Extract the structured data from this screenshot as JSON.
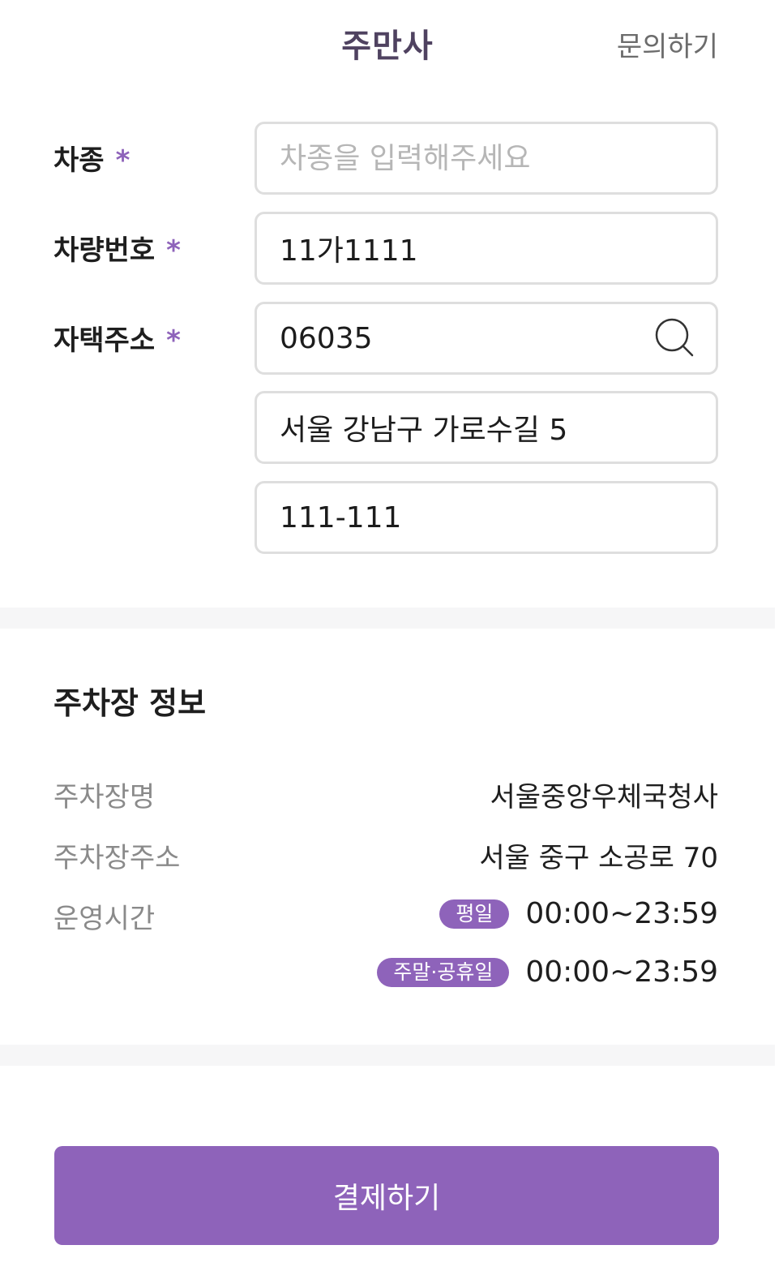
{
  "header": {
    "title": "주만사",
    "inquiry_label": "문의하기"
  },
  "form": {
    "required_mark": "*",
    "car_model": {
      "label": "차종",
      "placeholder": "차종을 입력해주세요",
      "value": ""
    },
    "plate_number": {
      "label": "차량번호",
      "value": "11가1111"
    },
    "home_address": {
      "label": "자택주소",
      "postal_code": "06035",
      "address": "서울 강남구 가로수길 5",
      "detail": "111-111"
    }
  },
  "parking_info": {
    "section_title": "주차장 정보",
    "name_label": "주차장명",
    "name_value": "서울중앙우체국청사",
    "address_label": "주차장주소",
    "address_value": "서울 중구 소공로 70",
    "hours_label": "운영시간",
    "weekday_badge": "평일",
    "weekday_hours": "00:00~23:59",
    "weekend_badge": "주말·공휴일",
    "weekend_hours": "00:00~23:59"
  },
  "pay_button_label": "결제하기",
  "colors": {
    "accent": "#8e63ba",
    "title": "#4f4260",
    "divider": "#f6f6f7",
    "border": "#dedede"
  },
  "icons": {
    "address_search": "search-icon"
  }
}
